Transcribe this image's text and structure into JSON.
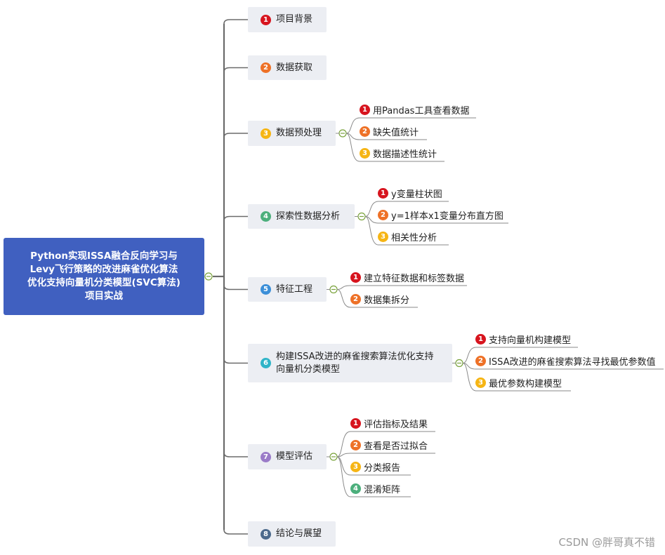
{
  "root": {
    "lines": [
      "Python实现ISSA融合反向学习与",
      "Levy飞行策略的改进麻雀优化算法",
      "优化支持向量机分类模型(SVC算法)",
      "项目实战"
    ]
  },
  "branches": [
    {
      "num": "1",
      "label": "项目背景",
      "color": "#d7141e",
      "children": []
    },
    {
      "num": "2",
      "label": "数据获取",
      "color": "#ee7127",
      "children": []
    },
    {
      "num": "3",
      "label": "数据预处理",
      "color": "#f6b514",
      "children": [
        {
          "num": "1",
          "label": "用Pandas工具查看数据",
          "color": "#d7141e"
        },
        {
          "num": "2",
          "label": "缺失值统计",
          "color": "#ee7127"
        },
        {
          "num": "3",
          "label": "数据描述性统计",
          "color": "#f6b514"
        }
      ]
    },
    {
      "num": "4",
      "label": "探索性数据分析",
      "color": "#4caf7c",
      "children": [
        {
          "num": "1",
          "label": "y变量柱状图",
          "color": "#d7141e"
        },
        {
          "num": "2",
          "label": "y=1样本x1变量分布直方图",
          "color": "#ee7127"
        },
        {
          "num": "3",
          "label": "相关性分析",
          "color": "#f6b514"
        }
      ]
    },
    {
      "num": "5",
      "label": "特征工程",
      "color": "#3c8fd8",
      "children": [
        {
          "num": "1",
          "label": "建立特征数据和标签数据",
          "color": "#d7141e"
        },
        {
          "num": "2",
          "label": "数据集拆分",
          "color": "#ee7127"
        }
      ]
    },
    {
      "num": "6",
      "label": "构建ISSA改进的麻雀搜索算法优化支持向量机分类模型",
      "color": "#2fb4c8",
      "label_lines": [
        "构建ISSA改进的麻雀搜索算法优化支持",
        "向量机分类模型"
      ],
      "children": [
        {
          "num": "1",
          "label": "支持向量机构建模型",
          "color": "#d7141e"
        },
        {
          "num": "2",
          "label": "ISSA改进的麻雀搜索算法寻找最优参数值",
          "color": "#ee7127"
        },
        {
          "num": "3",
          "label": "最优参数构建模型",
          "color": "#f6b514"
        }
      ]
    },
    {
      "num": "7",
      "label": "模型评估",
      "color": "#9a7bc8",
      "children": [
        {
          "num": "1",
          "label": "评估指标及结果",
          "color": "#d7141e"
        },
        {
          "num": "2",
          "label": "查看是否过拟合",
          "color": "#ee7127"
        },
        {
          "num": "3",
          "label": "分类报告",
          "color": "#f6b514"
        },
        {
          "num": "4",
          "label": "混淆矩阵",
          "color": "#4caf7c"
        }
      ]
    },
    {
      "num": "8",
      "label": "结论与展望",
      "color": "#4c6a8c",
      "children": []
    }
  ],
  "watermark": "CSDN @胖哥真不错"
}
